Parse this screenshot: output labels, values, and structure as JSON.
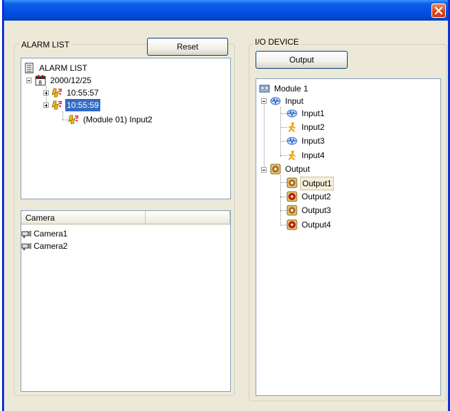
{
  "window": {
    "close_label": "Close"
  },
  "alarm_list": {
    "group_label": "ALARM LIST",
    "reset_button": "Reset",
    "tree": {
      "root_label": "ALARM LIST",
      "date_label": "2000/12/25",
      "time1_label": "10:55:57",
      "time2_label": "10:55:59",
      "event_label": "(Module 01) Input2"
    }
  },
  "camera_list": {
    "columns": [
      "Camera",
      ""
    ],
    "items": [
      "Camera1",
      "Camera2"
    ]
  },
  "io_device": {
    "group_label": "I/O DEVICE",
    "output_button": "Output",
    "tree": {
      "module_label": "Module 1",
      "input_group": "Input",
      "inputs": [
        "Input1",
        "Input2",
        "Input3",
        "Input4"
      ],
      "output_group": "Output",
      "outputs": [
        "Output1",
        "Output2",
        "Output3",
        "Output4"
      ]
    }
  },
  "colors": {
    "title_bar": "#0553e6",
    "selection": "#316ac5",
    "window_bg": "#ece9d8"
  }
}
